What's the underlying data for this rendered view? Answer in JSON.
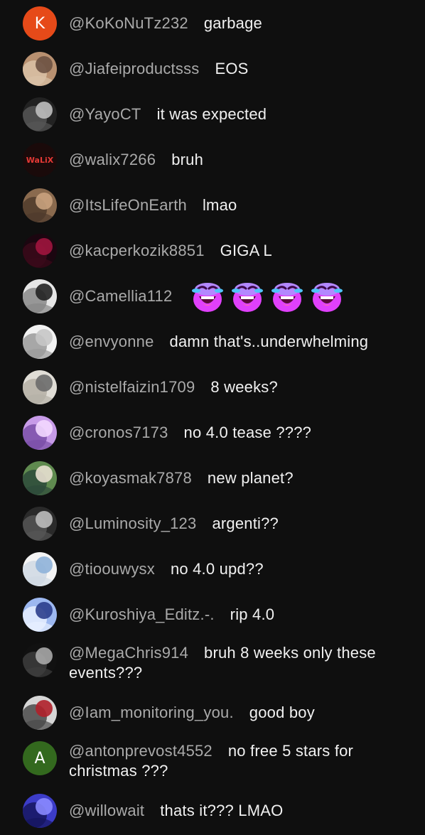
{
  "chat": {
    "messages": [
      {
        "author": "@KoKoNuTz232",
        "text": "garbage",
        "avatar": {
          "letter": "K",
          "color": "#e64a19"
        }
      },
      {
        "author": "@Jiafeiproductsss",
        "text": "EOS",
        "avatar": {
          "colors": [
            "#b89070",
            "#6d5243",
            "#d9c2a6"
          ]
        }
      },
      {
        "author": "@YayoCT",
        "text": "it was expected",
        "avatar": {
          "colors": [
            "#222222",
            "#bfbfbf",
            "#555555"
          ]
        }
      },
      {
        "author": "@walix7266",
        "text": "bruh",
        "avatar": {
          "letter": "WaLiX",
          "color": "#1a0a0a"
        }
      },
      {
        "author": "@ItsLifeOnEarth",
        "text": "lmao",
        "avatar": {
          "colors": [
            "#8a6a4e",
            "#c9a27e",
            "#4f3b2c"
          ]
        }
      },
      {
        "author": "@kacperkozik8851",
        "text": "GIGA L",
        "avatar": {
          "colors": [
            "#1b0610",
            "#a0153e",
            "#3a0a1a"
          ]
        }
      },
      {
        "author": "@Camellia112",
        "text": "",
        "emoji_count": 4,
        "emoji_name": "rolling-laughing-face-emoji",
        "avatar": {
          "colors": [
            "#e6e6e6",
            "#222222",
            "#888888"
          ]
        }
      },
      {
        "author": "@envyonne",
        "text": "damn that's..underwhelming",
        "avatar": {
          "colors": [
            "#f2f2f2",
            "#c7c7c7",
            "#9a9a9a"
          ]
        }
      },
      {
        "author": "@nistelfaizin1709",
        "text": "8 weeks?",
        "avatar": {
          "colors": [
            "#e0ddd6",
            "#6b6b6b",
            "#b5b0a6"
          ]
        }
      },
      {
        "author": "@cronos7173",
        "text": "no 4.0 tease ????",
        "avatar": {
          "colors": [
            "#c79be8",
            "#f3d8ff",
            "#7a4fa8"
          ]
        }
      },
      {
        "author": "@koyasmak7878",
        "text": "new planet?",
        "avatar": {
          "colors": [
            "#5f8a4f",
            "#e8e0d0",
            "#2d4a3a"
          ]
        }
      },
      {
        "author": "@Luminosity_123",
        "text": "argenti??",
        "avatar": {
          "colors": [
            "#2a2a2a",
            "#bdbdbd",
            "#555555"
          ]
        }
      },
      {
        "author": "@tioouwysx",
        "text": "no 4.0 upd??",
        "avatar": {
          "colors": [
            "#f4f4f4",
            "#8fb3d9",
            "#cfd8e3"
          ]
        }
      },
      {
        "author": "@Kuroshiya_Editz.-.",
        "text": "rip 4.0",
        "avatar": {
          "colors": [
            "#9db8f0",
            "#2c3e8c",
            "#e7efff"
          ]
        }
      },
      {
        "author": "@MegaChris914",
        "text": "bruh 8 weeks only these events???",
        "avatar": {
          "colors": [
            "#111111",
            "#a9a9a9",
            "#3d3d3d"
          ]
        }
      },
      {
        "author": "@Iam_monitoring_you.",
        "text": "good boy",
        "avatar": {
          "colors": [
            "#d6d6d6",
            "#b0202a",
            "#4a4a4a"
          ]
        }
      },
      {
        "author": "@antonprevost4552",
        "text": "no free 5 stars for christmas ???",
        "avatar": {
          "letter": "A",
          "color": "#33691e"
        }
      },
      {
        "author": "@willowait",
        "text": "thats it??? LMAO",
        "avatar": {
          "colors": [
            "#3c3cc8",
            "#8a8aff",
            "#161660"
          ]
        }
      }
    ]
  }
}
